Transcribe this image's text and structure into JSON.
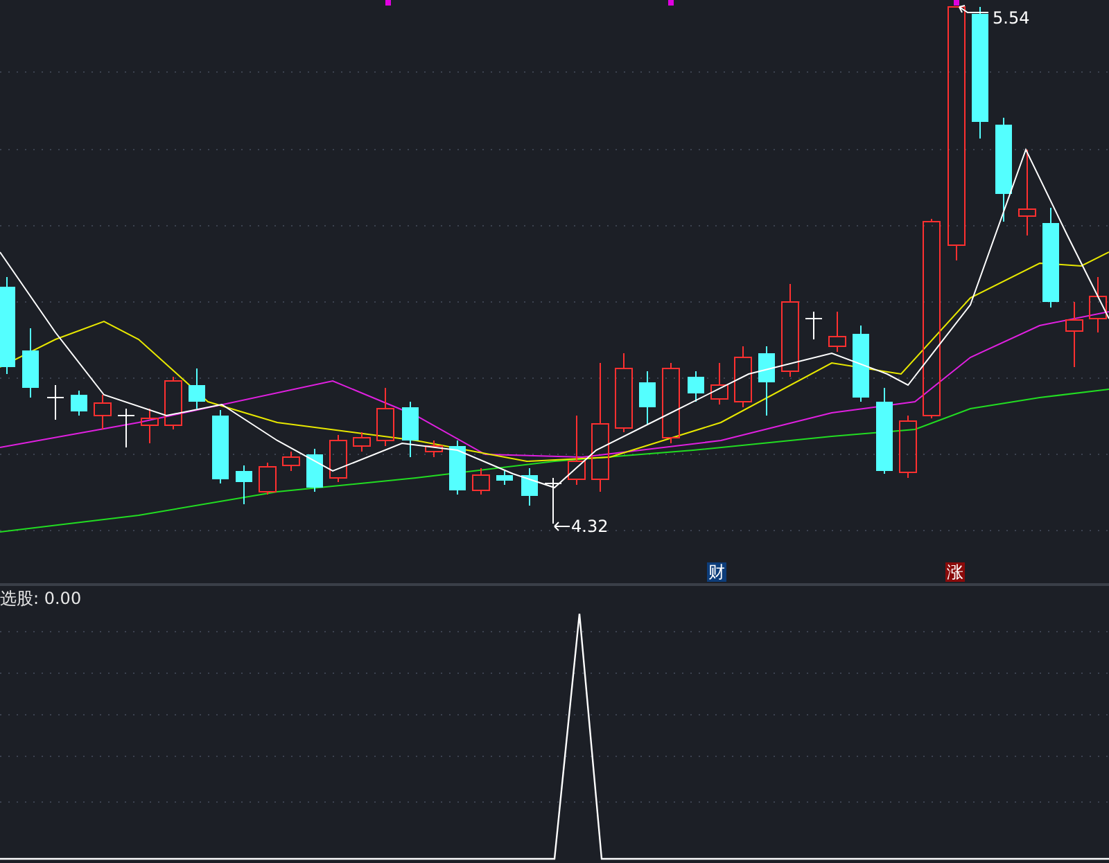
{
  "price_chart": {
    "high_label": "5.54",
    "low_label": "4.32",
    "markers": [
      {
        "text": "财",
        "kind": "finance"
      },
      {
        "text": "涨",
        "kind": "limit-up"
      }
    ]
  },
  "indicator": {
    "label": "选股: 0.00"
  }
}
